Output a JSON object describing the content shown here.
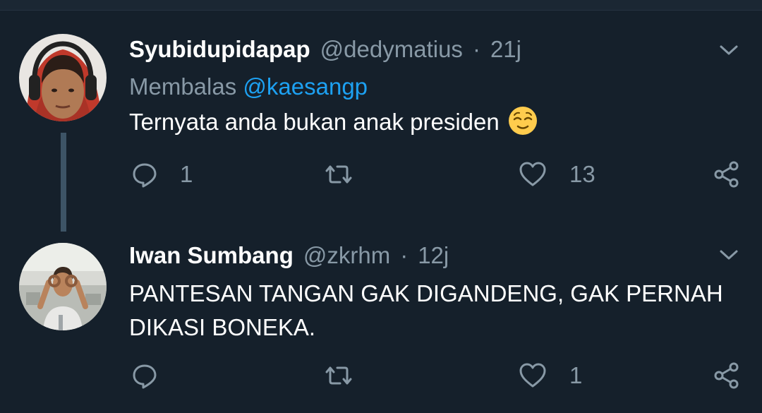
{
  "tweets": [
    {
      "name": "Syubidupidapap",
      "handle": "@dedymatius",
      "dot": "·",
      "time": "21j",
      "reply_prefix": "Membalas",
      "reply_to": "@kaesangp",
      "text": "Ternyata anda bukan anak presiden",
      "emoji": "relieved-face-emoji",
      "reply_count": "1",
      "retweet_count": "",
      "like_count": "13"
    },
    {
      "name": "Iwan Sumbang",
      "handle": "@zkrhm",
      "dot": "·",
      "time": "12j",
      "text_line1": "PANTESAN TANGAN GAK DIGANDENG, GAK PERNAH",
      "text_line2": "DIKASI BONEKA.",
      "reply_count": "",
      "retweet_count": "",
      "like_count": "1"
    }
  ],
  "colors": {
    "background": "#15202b",
    "secondary_text": "#8899a6",
    "mention": "#1da1f2",
    "thread_line": "#3d5466"
  },
  "icons": [
    "reply-icon",
    "retweet-icon",
    "like-icon",
    "share-icon",
    "chevron-down-icon"
  ]
}
